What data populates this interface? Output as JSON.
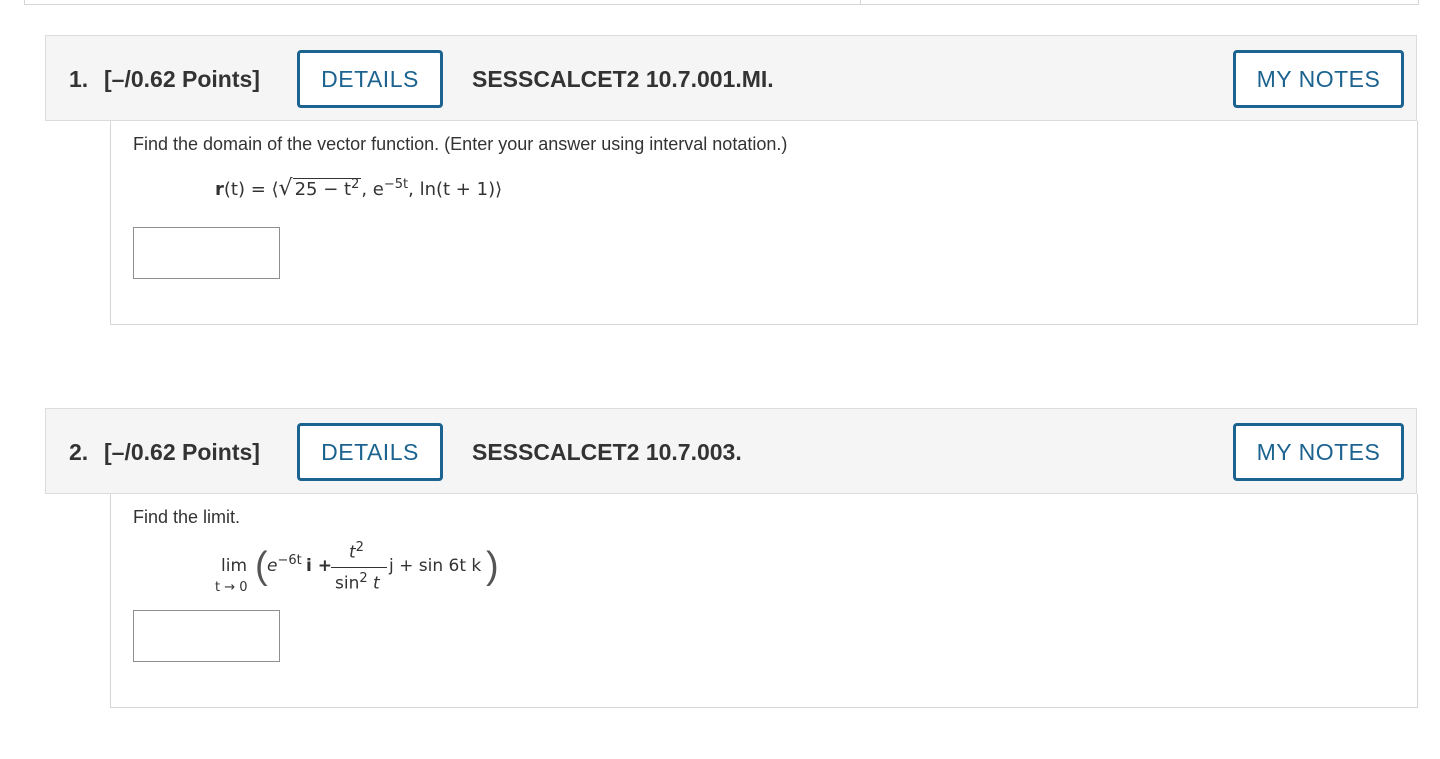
{
  "questions": [
    {
      "number": "1.",
      "points": "[–/0.62 Points]",
      "details_label": "DETAILS",
      "code": "SESSCALCET2 10.7.001.MI.",
      "notes_label": "MY NOTES",
      "prompt": "Find the domain of the vector function. (Enter your answer using interval notation.)",
      "math": {
        "r": "r",
        "t_open": "(t) = ⟨",
        "radicand": "25 − t",
        "sq": "2",
        "e_part": ", e",
        "e_exp": "−5t",
        "ln_part": ", ln(t + 1)⟩"
      },
      "answer_value": ""
    },
    {
      "number": "2.",
      "points": "[–/0.62 Points]",
      "details_label": "DETAILS",
      "code": "SESSCALCET2 10.7.003.",
      "notes_label": "MY NOTES",
      "prompt": "Find the limit.",
      "math": {
        "lim": "lim",
        "lim_sub": "t → 0",
        "e": "e",
        "e_exp": "−6t",
        "i": "i +",
        "frac_num": "t",
        "frac_num_exp": "2",
        "frac_den": "sin",
        "frac_den_exp": "2",
        "frac_den_t": " t",
        "rest": "j + sin 6t k"
      },
      "answer_value": ""
    }
  ]
}
